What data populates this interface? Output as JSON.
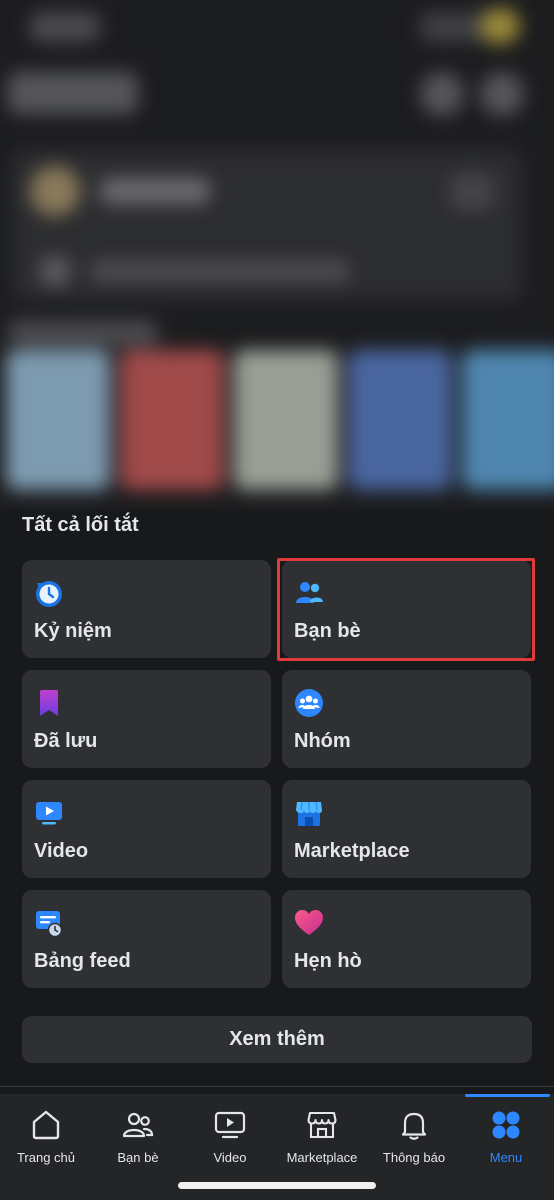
{
  "shortcuts": {
    "title": "Tất cả lối tắt",
    "items": [
      {
        "label": "Kỷ niệm",
        "icon": "memories-clock-icon"
      },
      {
        "label": "Bạn bè",
        "icon": "friends-icon"
      },
      {
        "label": "Đã lưu",
        "icon": "saved-bookmark-icon"
      },
      {
        "label": "Nhóm",
        "icon": "groups-icon"
      },
      {
        "label": "Video",
        "icon": "video-play-icon"
      },
      {
        "label": "Marketplace",
        "icon": "marketplace-shop-icon"
      },
      {
        "label": "Bảng feed",
        "icon": "feeds-icon"
      },
      {
        "label": "Hẹn hò",
        "icon": "dating-heart-icon"
      }
    ],
    "see_more": "Xem thêm"
  },
  "tabbar": {
    "items": [
      {
        "label": "Trang chủ",
        "icon": "home-icon"
      },
      {
        "label": "Bạn bè",
        "icon": "friends-outline-icon"
      },
      {
        "label": "Video",
        "icon": "video-outline-icon"
      },
      {
        "label": "Marketplace",
        "icon": "marketplace-outline-icon"
      },
      {
        "label": "Thông báo",
        "icon": "bell-icon"
      },
      {
        "label": "Menu",
        "icon": "menu-grid-icon",
        "active": true
      }
    ]
  },
  "colors": {
    "accent": "#2d88ff",
    "highlight_box": "#e03a3a",
    "card_bg": "#2f3033",
    "page_bg": "#18191a"
  }
}
